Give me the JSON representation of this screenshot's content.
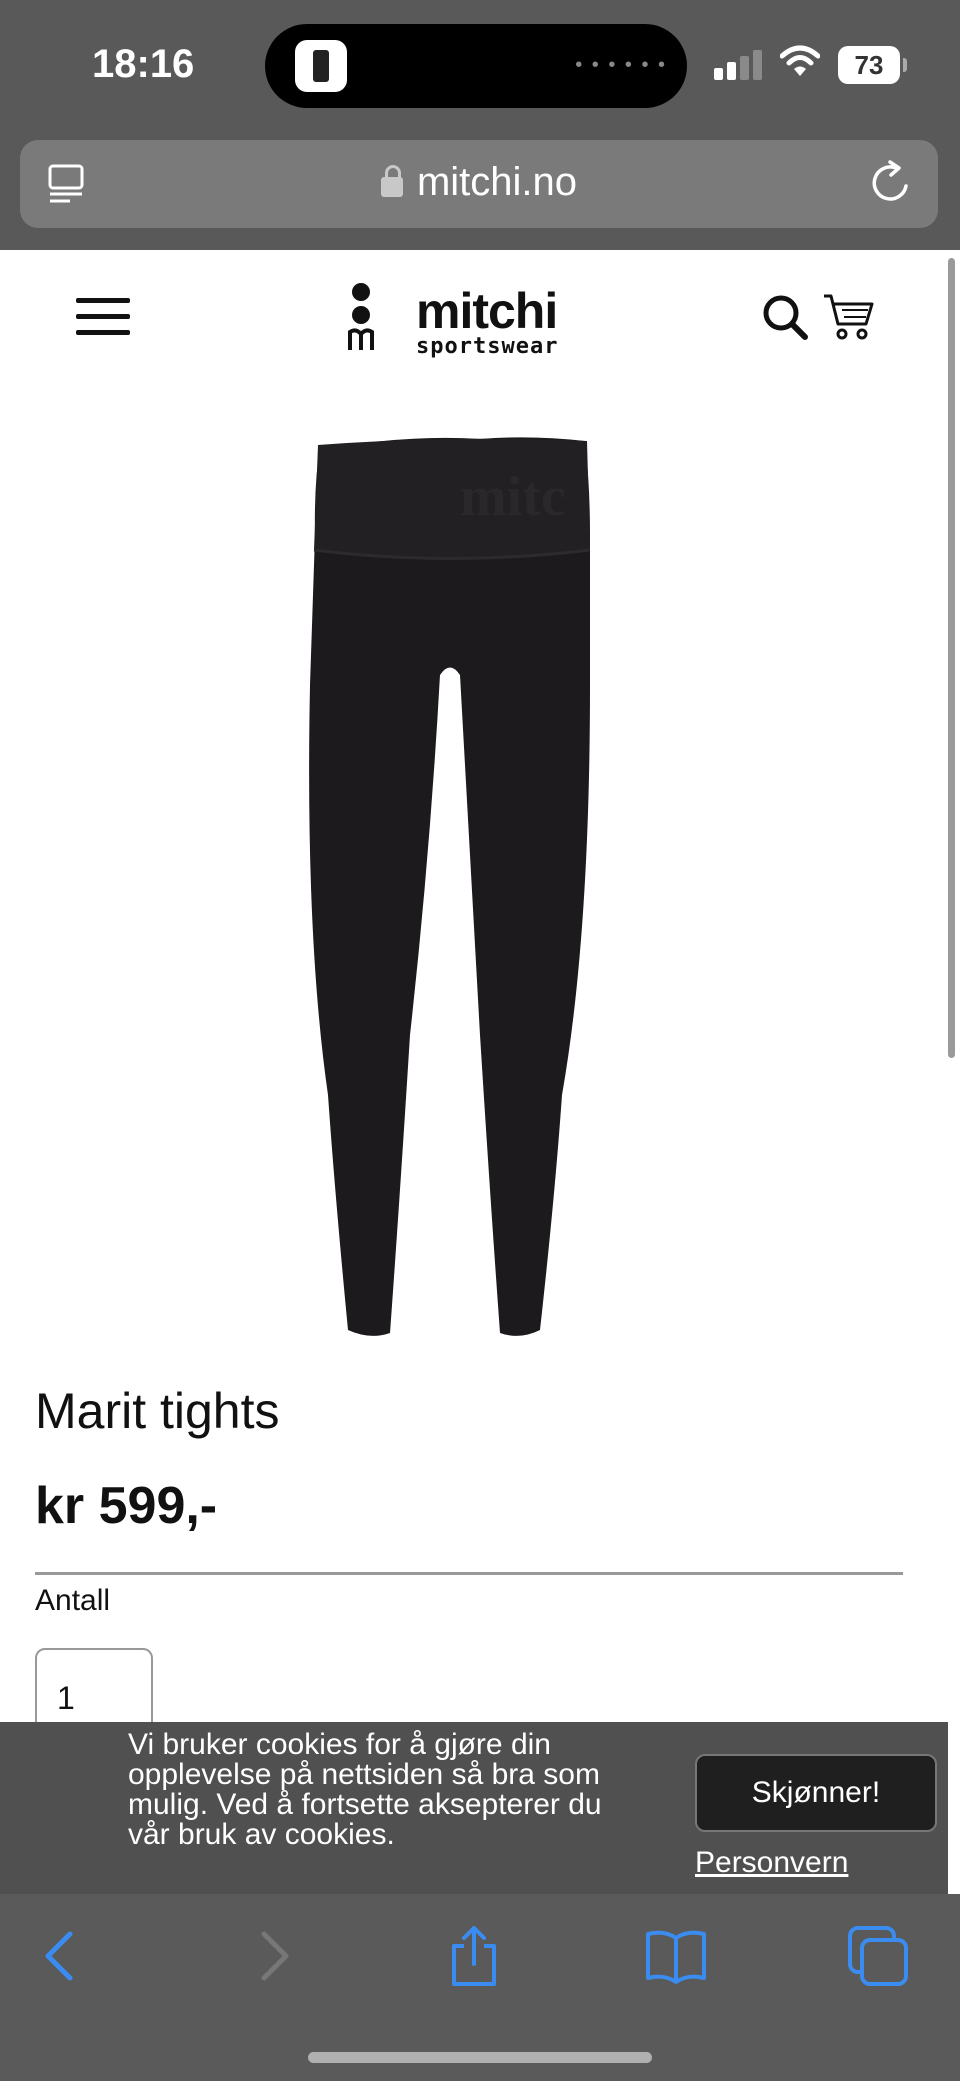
{
  "status_bar": {
    "time": "18:16",
    "battery": "73"
  },
  "browser": {
    "url": "mitchi.no"
  },
  "site": {
    "logo_word": "mitchi",
    "logo_sub": "sportswear"
  },
  "product": {
    "title": "Marit tights",
    "price": "kr 599,-",
    "quantity_label": "Antall",
    "quantity_value": "1"
  },
  "cookie_banner": {
    "text": "Vi bruker cookies for å gjøre din opplevelse på nettsiden så bra som mulig. Ved å fortsette aksepterer du vår bruk av cookies.",
    "accept_label": "Skjønner!",
    "privacy_link": "Personvern"
  },
  "toolbar": {
    "back_icon": "chevron-left-icon",
    "forward_icon": "chevron-right-icon",
    "share_icon": "share-icon",
    "bookmarks_icon": "book-icon",
    "tabs_icon": "tabs-icon"
  }
}
